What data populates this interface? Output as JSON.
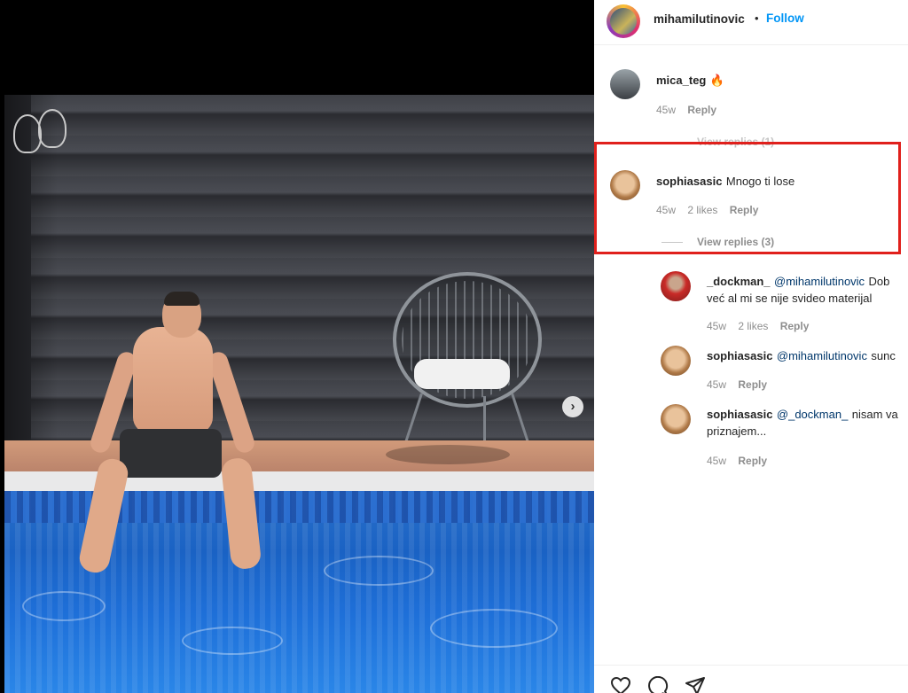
{
  "post": {
    "author": "mihamilutinovic",
    "separator": "•",
    "follow_label": "Follow",
    "next_label": "›"
  },
  "comments": [
    {
      "user": "mica_teg",
      "text": "🔥",
      "age": "45w",
      "reply_label": "Reply",
      "view_replies": "View replies (1)"
    },
    {
      "user": "sophiasasic",
      "text": "Mnogo ti lose",
      "age": "45w",
      "likes": "2 likes",
      "reply_label": "Reply",
      "view_replies": "View replies (3)"
    }
  ],
  "replies": [
    {
      "user": "_dockman_",
      "mention": "@mihamilutinovic",
      "text": "Dob",
      "text2": "već al mi se nije svideo materijal",
      "age": "45w",
      "likes": "2 likes",
      "reply_label": "Reply"
    },
    {
      "user": "sophiasasic",
      "mention": "@mihamilutinovic",
      "text": "sunc",
      "age": "45w",
      "reply_label": "Reply"
    },
    {
      "user": "sophiasasic",
      "mention": "@_dockman_",
      "text": "nisam va",
      "text2": "priznajem...",
      "age": "45w",
      "reply_label": "Reply"
    }
  ],
  "icons": [
    "heart-icon",
    "comment-icon",
    "share-icon",
    "fire-emoji"
  ],
  "colors": {
    "accent": "#0095f6",
    "highlight": "#e0201c",
    "mention": "#00376b"
  }
}
